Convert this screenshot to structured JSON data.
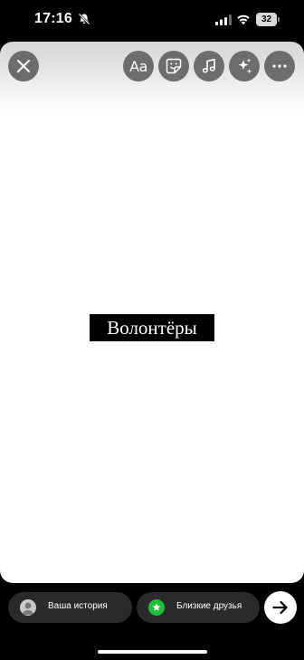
{
  "status_bar": {
    "time": "17:16",
    "battery_level": "32",
    "icons": [
      "bell-slash-icon",
      "signal-icon",
      "wifi-icon",
      "battery-icon"
    ]
  },
  "toolbar": {
    "text_tool_label": "Aa",
    "icons": [
      "close-icon",
      "sticker-icon",
      "music-icon",
      "sparkles-icon",
      "more-icon"
    ]
  },
  "canvas": {
    "story_text": "Волонтёры",
    "text_background_color": "#000000",
    "text_color": "#ffffff",
    "background_color": "#ffffff"
  },
  "bottom_bar": {
    "your_story_label": "Ваша история",
    "close_friends_label": "Близкие друзья",
    "close_friends_color": "#1fbf3a",
    "icons": [
      "avatar",
      "star-icon",
      "arrow-right-icon"
    ]
  }
}
